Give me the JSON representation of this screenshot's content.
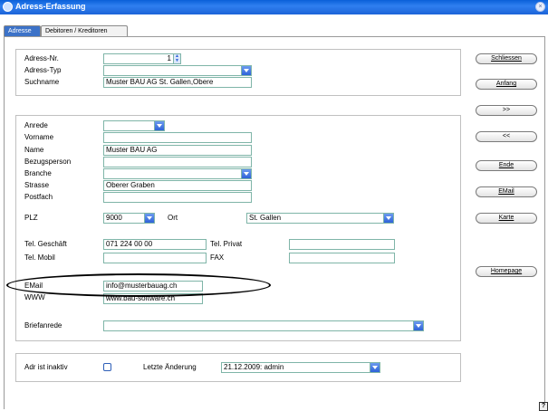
{
  "window": {
    "title": "Adress-Erfassung",
    "close_glyph": "×"
  },
  "tabs": [
    {
      "label": "Adresse"
    },
    {
      "label": "Debitoren / Kreditoren"
    }
  ],
  "top": {
    "adress_nr": {
      "label": "Adress-Nr.",
      "value": "1"
    },
    "adress_typ": {
      "label": "Adress-Typ",
      "value": ""
    },
    "suchname": {
      "label": "Suchname",
      "value": "Muster BAU AG St. Gallen,Obere"
    }
  },
  "person": {
    "anrede": {
      "label": "Anrede",
      "value": ""
    },
    "vorname": {
      "label": "Vorname",
      "value": ""
    },
    "name": {
      "label": "Name",
      "value": "Muster BAU AG"
    },
    "bezugsperson": {
      "label": "Bezugsperson",
      "value": ""
    },
    "branche": {
      "label": "Branche",
      "value": ""
    },
    "strasse": {
      "label": "Strasse",
      "value": "Oberer Graben"
    },
    "postfach": {
      "label": "Postfach",
      "value": ""
    },
    "plz": {
      "label": "PLZ",
      "value": "9000"
    },
    "ort": {
      "label": "Ort",
      "value": "St. Gallen"
    },
    "tel_geschaeft": {
      "label": "Tel. Geschäft",
      "value": "071 224 00 00"
    },
    "tel_privat": {
      "label": "Tel. Privat",
      "value": ""
    },
    "tel_mobil": {
      "label": "Tel. Mobil",
      "value": ""
    },
    "fax": {
      "label": "FAX",
      "value": ""
    },
    "email": {
      "label": "EMail",
      "value": "info@musterbauag.ch"
    },
    "www": {
      "label": "WWW",
      "value": "www.bau-software.ch"
    },
    "briefanrede": {
      "label": "Briefanrede",
      "value": ""
    }
  },
  "bottom": {
    "inaktiv_label": "Adr ist inaktiv",
    "letzte_label": "Letzte Änderung",
    "letzte_value": "21.12.2009: admin"
  },
  "buttons": {
    "schliessen": "Schliessen",
    "anfang": "Anfang",
    "next": ">>",
    "prev": "<<",
    "ende": "Ende",
    "email": "EMail",
    "karte": "Karte",
    "homepage": "Homepage"
  },
  "help_glyph": "?",
  "spin_up": "▲",
  "spin_down": "▼"
}
